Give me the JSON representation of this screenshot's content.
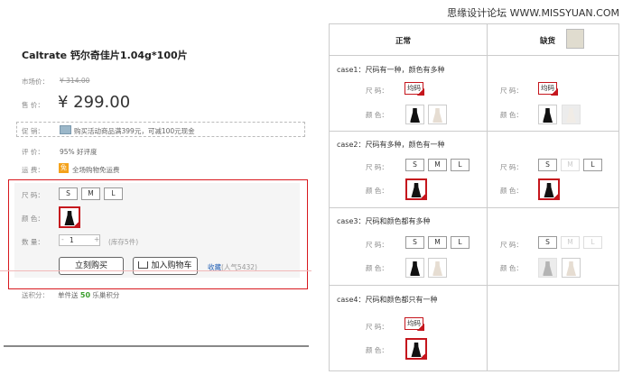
{
  "watermark": "思缘设计论坛 WWW.MISSYUAN.COM",
  "product": {
    "title": "Caltrate 钙尔奇佳片1.04g*100片",
    "market_label": "市场价：",
    "market_price": "¥ 314.00",
    "price_label": "售  价：",
    "price": "¥ 299.00",
    "promo_label": "促  销：",
    "promo_text": "购买活动商品满399元，可减100元现金",
    "rating_label": "评  价：",
    "rating_text": "95% 好评度",
    "shipping_label": "运  费：",
    "shipping_badge": "免",
    "shipping_text": "全场购物免运费",
    "size_label": "尺  码：",
    "sizes": [
      "S",
      "M",
      "L"
    ],
    "color_label": "颜  色：",
    "qty_label": "数  量：",
    "qty_minus": "-",
    "qty_value": "1",
    "qty_plus": "+",
    "stock_text": "(库存5件)",
    "buy_button": "立刻购买",
    "cart_button": "加入购物车",
    "fav_text": "收藏",
    "popularity": "(人气5432)",
    "points_label": "送积分：",
    "points_prefix": "单件送",
    "points_value": "50",
    "points_suffix": "乐巢积分"
  },
  "table": {
    "col_normal": "正常",
    "col_out": "缺货",
    "size_label": "尺  码：",
    "color_label": "颜  色：",
    "sizes": [
      "S",
      "M",
      "L"
    ],
    "one_size": "均码",
    "cases": [
      "case1：尺码有一种，颜色有多种",
      "case2：尺码有多种，颜色有一种",
      "case3：尺码和颜色都有多种",
      "case4：尺码和颜色都只有一种"
    ]
  },
  "colors": {
    "accent_red": "#c5161d",
    "link_blue": "#2260b5",
    "points_green": "#3a9e2d",
    "badge_orange": "#f4a21b"
  }
}
